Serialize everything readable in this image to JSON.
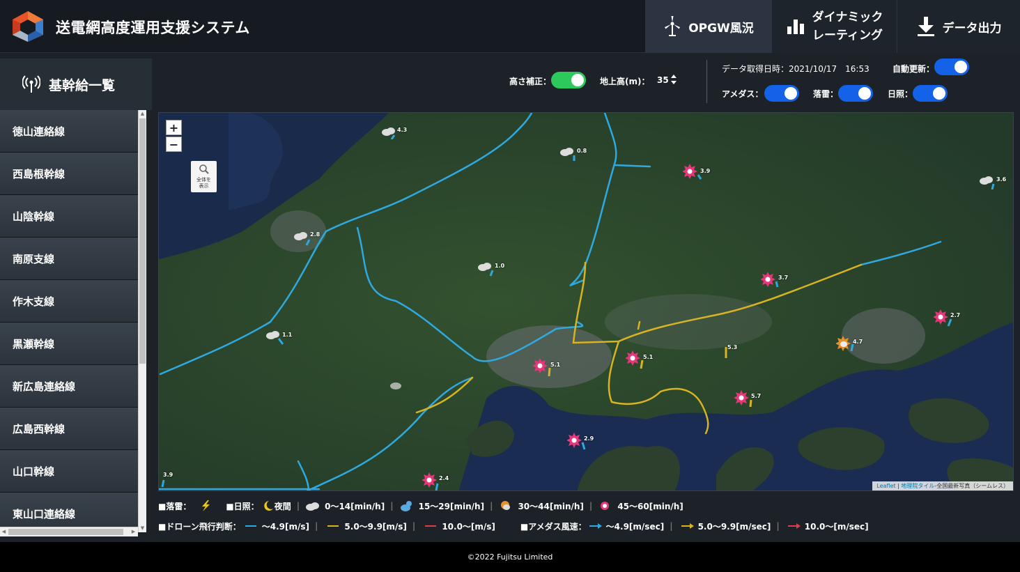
{
  "header": {
    "title": "送電網高度運用支援システム",
    "buttons": {
      "opgw": "OPGW風況",
      "dynamic_line1": "ダイナミック",
      "dynamic_line2": "レーティング",
      "export": "データ出力"
    }
  },
  "sidebar": {
    "title": "基幹給一覧",
    "items": [
      {
        "label": "徳山連絡線"
      },
      {
        "label": "西島根幹線"
      },
      {
        "label": "山陰幹線"
      },
      {
        "label": "南原支線"
      },
      {
        "label": "作木支線"
      },
      {
        "label": "黒瀬幹線"
      },
      {
        "label": "新広島連絡線"
      },
      {
        "label": "広島西幹線"
      },
      {
        "label": "山口幹線"
      },
      {
        "label": "東山口連絡線"
      }
    ]
  },
  "controls": {
    "height_correction_label": "高さ補正：",
    "ground_height_label": "地上高(m)：",
    "ground_height_value": "35",
    "acquired_label": "データ取得日時：2021/10/17　16:53",
    "auto_update_label": "自動更新：",
    "amedas_label": "アメダス：",
    "lightning_label": "落雷：",
    "sunshine_label": "日照：",
    "toggles": {
      "height_correction": true,
      "auto_update": true,
      "amedas": true,
      "lightning": true,
      "sunshine": true
    }
  },
  "map": {
    "zoom_in": "+",
    "zoom_out": "−",
    "fit_line1": "全体を",
    "fit_line2": "表示",
    "attribution_link": "Leaflet",
    "attribution_sep": " | ",
    "attribution_gsi": "地理院タイル",
    "attribution_rest": "-全国最新写真（シームレス）",
    "markers": [
      {
        "label": "4.3",
        "icon": "cloud-icon"
      },
      {
        "label": "0.8",
        "icon": "cloud-icon"
      },
      {
        "label": "3.9",
        "icon": "sun-icon"
      },
      {
        "label": "3.6",
        "icon": "cloud-icon"
      },
      {
        "label": "2.8",
        "icon": "cloud-icon"
      },
      {
        "label": "1.0",
        "icon": "cloud-icon"
      },
      {
        "label": "3.7",
        "icon": "sun-icon"
      },
      {
        "label": "1.1",
        "icon": "cloud-icon"
      },
      {
        "label": "5.1",
        "icon": "sun-icon"
      },
      {
        "label": "5.1",
        "icon": "sun-icon"
      },
      {
        "label": "5.3",
        "icon": "arrow-icon"
      },
      {
        "label": "4.7",
        "icon": "cloud-sun-icon"
      },
      {
        "label": "2.7",
        "icon": "sun-icon"
      },
      {
        "label": "5.7",
        "icon": "sun-icon"
      },
      {
        "label": "2.9",
        "icon": "sun-icon"
      },
      {
        "label": "2.4",
        "icon": "sun-icon"
      },
      {
        "label": "3.9",
        "icon": "arrow-icon"
      }
    ]
  },
  "legend": {
    "lightning": "■落雷：",
    "sunshine": "■日照：",
    "night": "夜間",
    "s1": "0～14[min/h]",
    "s2": "15～29[min/h]",
    "s3": "30～44[min/h]",
    "s4": "45～60[min/h]",
    "drone": "■ドローン飛行判断：",
    "d1": "～4.9[m/s]",
    "d2": "5.0～9.9[m/s]",
    "d3": "10.0～[m/s]",
    "amedas": "■アメダス風速：",
    "a1": "～4.9[m/sec]",
    "a2": "5.0～9.9[m/sec]",
    "a3": "10.0～[m/sec]",
    "colors": {
      "blue": "#2fa9e0",
      "yellow": "#d8b423",
      "red": "#e23b4a"
    }
  },
  "footer": {
    "text": "©2022 Fujitsu Limited"
  }
}
